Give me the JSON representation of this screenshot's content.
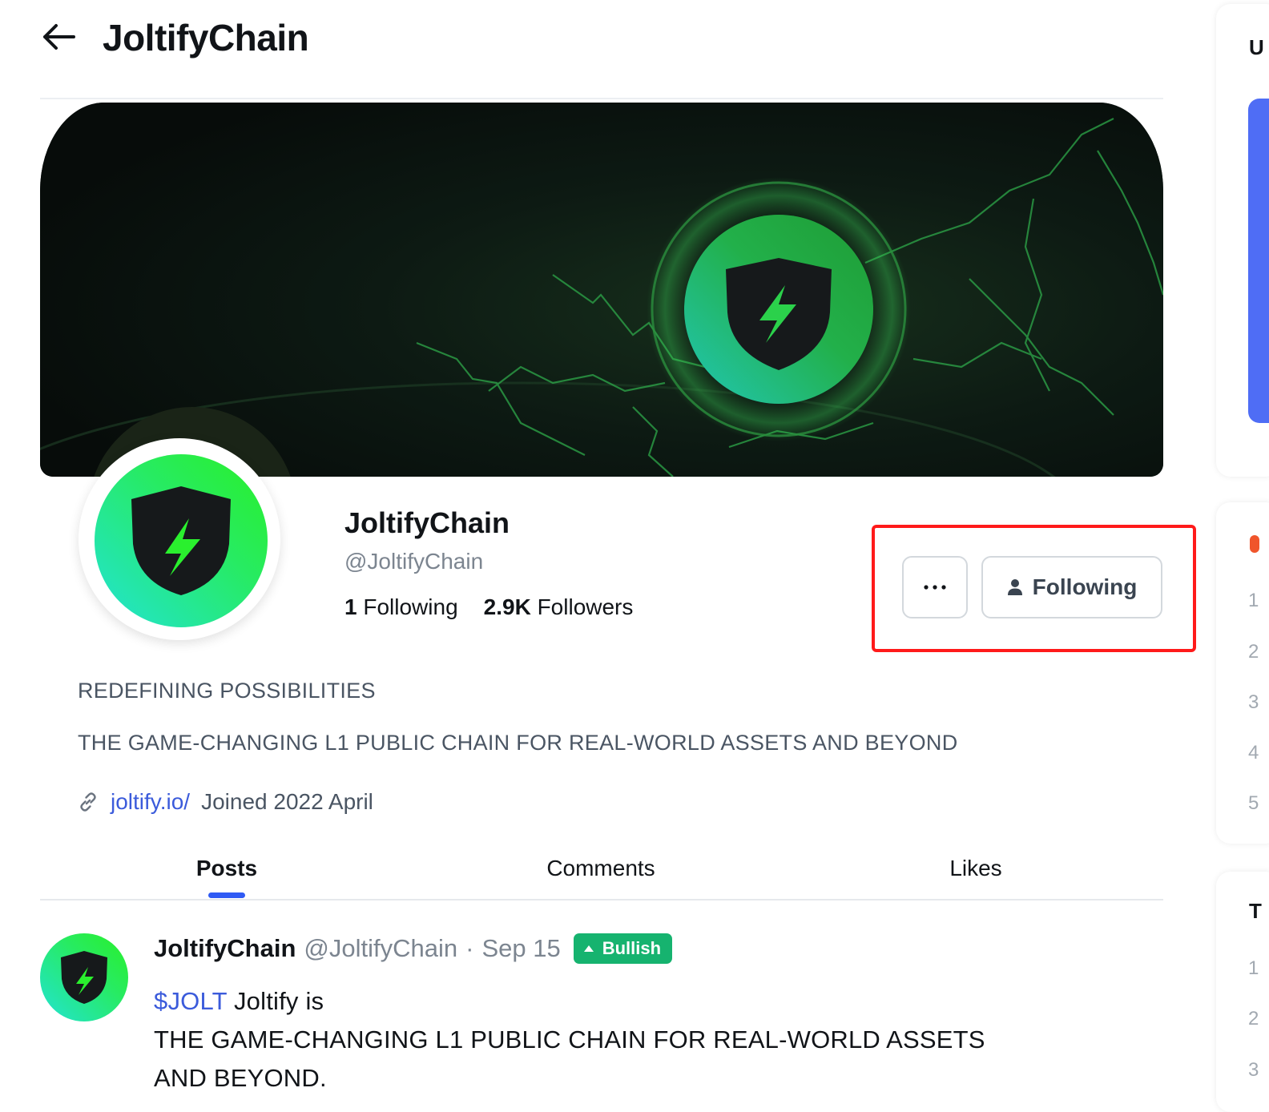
{
  "header": {
    "title": "JoltifyChain",
    "back_icon": "arrow-left-icon"
  },
  "profile": {
    "name": "JoltifyChain",
    "handle": "@JoltifyChain",
    "following_count": "1",
    "following_label": "Following",
    "followers_count": "2.9K",
    "followers_label": "Followers",
    "bio_line_1": "REDEFINING POSSIBILITIES",
    "bio_line_2": "THE GAME-CHANGING L1 PUBLIC CHAIN FOR REAL-WORLD ASSETS AND BEYOND",
    "website": "joltify.io/",
    "joined": "Joined 2022 April",
    "brand_gradient": [
      "#22d6c8",
      "#2af02e"
    ],
    "shield_color": "#16191b"
  },
  "actions": {
    "more_icon": "ellipsis-icon",
    "follow_label": "Following",
    "follow_icon": "person-icon",
    "highlight_color": "#ff1a1a"
  },
  "tabs": [
    {
      "label": "Posts",
      "active": true
    },
    {
      "label": "Comments",
      "active": false
    },
    {
      "label": "Likes",
      "active": false
    }
  ],
  "post": {
    "author": "JoltifyChain",
    "handle": "@JoltifyChain",
    "separator": "·",
    "date": "Sep 15",
    "sentiment": "Bullish",
    "sentiment_color": "#16b36f",
    "cashtag": "$JOLT",
    "text_1": " Joltify is",
    "text_2": "THE GAME-CHANGING L1 PUBLIC CHAIN FOR REAL-WORLD ASSETS AND BEYOND."
  },
  "sidebar_fragments": {
    "card1_heading": "U",
    "card2_numbers": [
      "1",
      "2",
      "3",
      "4",
      "5"
    ],
    "card3_heading": "T",
    "card3_numbers": [
      "1",
      "2",
      "3"
    ]
  }
}
